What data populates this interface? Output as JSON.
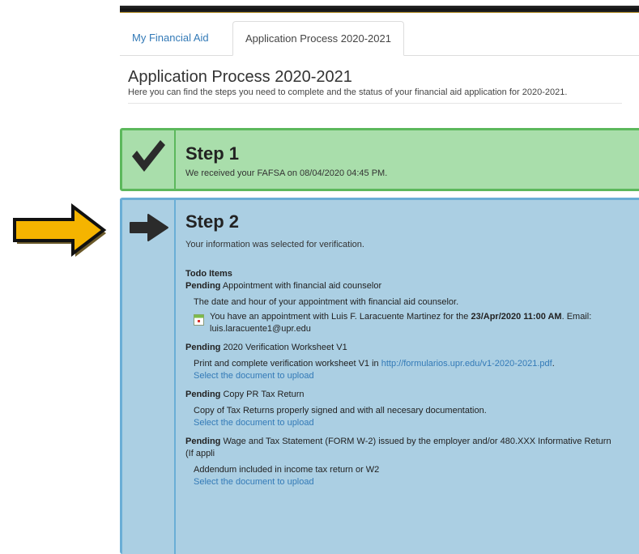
{
  "tabs": [
    {
      "label": "My Financial Aid"
    },
    {
      "label": "Application Process 2020-2021"
    }
  ],
  "page": {
    "title": "Application Process 2020-2021",
    "description": "Here you can find the steps you need to complete and the status of your financial aid application for 2020-2021."
  },
  "steps": [
    {
      "icon": "checkmark-icon",
      "title": "Step 1",
      "subtitle": "We received your FAFSA on 08/04/2020 04:45 PM.",
      "color": "#a9deab"
    },
    {
      "icon": "arrow-right-icon",
      "title": "Step 2",
      "subtitle": "Your information was selected for verification.",
      "color": "#abcfe3",
      "todo_heading": "Todo Items",
      "items": [
        {
          "status": "Pending",
          "title": " Appointment with financial aid counselor",
          "description": "The date and hour of your appointment with financial aid counselor.",
          "appointment_pre": "You have an appointment with Luis F. Laracuente Martinez for the ",
          "appointment_date": "23/Apr/2020 11:00 AM",
          "appointment_post": ". Email: luis.laracuente1@upr.edu"
        },
        {
          "status": "Pending",
          "title": " 2020 Verification Worksheet V1",
          "description": "Print and complete verification worksheet V1 in ",
          "link": "http://formularios.upr.edu/v1-2020-2021.pdf",
          "link_suffix": ".",
          "upload": "Select the document to upload"
        },
        {
          "status": "Pending",
          "title": " Copy PR Tax Return",
          "description": "Copy of Tax Returns properly signed and with all necesary documentation.",
          "upload": "Select the document to upload"
        },
        {
          "status": "Pending",
          "title": " Wage and Tax Statement (FORM W-2) issued by the employer and/or 480.XXX Informative Return (If appli",
          "description": "Addendum included in income tax return or W2",
          "upload": "Select the document to upload"
        }
      ]
    }
  ],
  "annotation": {
    "icon": "annotation-arrow-icon",
    "color": "#f5b400"
  }
}
